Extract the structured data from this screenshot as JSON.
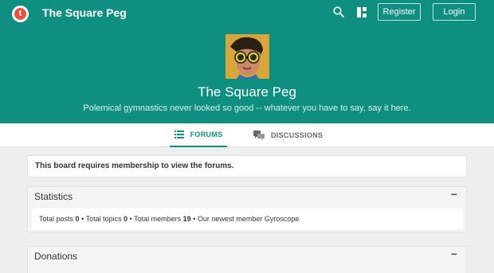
{
  "header": {
    "logo_letter": "t",
    "site_title": "The Square Peg",
    "register_label": "Register",
    "login_label": "Login"
  },
  "board": {
    "title": "The Square Peg",
    "description": "Polemical gymnastics never looked so good -- whatever you have to say, say it here."
  },
  "tabs": {
    "forums": "FORUMS",
    "discussions": "DISCUSSIONS"
  },
  "notice": "This board requires membership to view the forums.",
  "statistics": {
    "title": "Statistics",
    "toggle": "−",
    "total_posts_label": "Total posts",
    "total_posts": "0",
    "total_topics_label": "• Total topics",
    "total_topics": "0",
    "total_members_label": "• Total members",
    "total_members": "19",
    "newest_member_label": "• Our newest member",
    "newest_member": "Gyroscope"
  },
  "donations": {
    "title": "Donations",
    "toggle": "−"
  },
  "colors": {
    "brand": "#0f8f80",
    "logo_accent": "#f04f3d"
  }
}
